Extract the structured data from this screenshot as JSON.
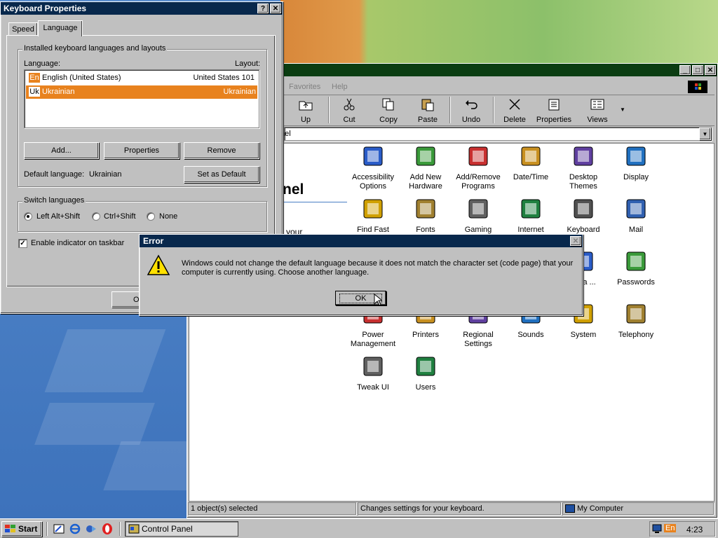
{
  "keyboard_props": {
    "title": "Keyboard Properties",
    "help_btn": "?",
    "close_btn": "✕",
    "tabs": [
      "Speed",
      "Language"
    ],
    "installed_group": "Installed keyboard languages and layouts",
    "col_language": "Language:",
    "col_layout": "Layout:",
    "rows": [
      {
        "code": "En",
        "language": "English (United States)",
        "layout": "United States 101"
      },
      {
        "code": "Uk",
        "language": "Ukrainian",
        "layout": "Ukrainian"
      }
    ],
    "add_btn": "Add...",
    "properties_btn": "Properties",
    "remove_btn": "Remove",
    "default_label": "Default language:",
    "default_value": "Ukrainian",
    "set_default_btn": "Set as Default",
    "switch_group": "Switch languages",
    "switch_options": [
      "Left Alt+Shift",
      "Ctrl+Shift",
      "None"
    ],
    "indicator_label": "Enable indicator on taskbar",
    "ok_partial": "OK"
  },
  "control_panel": {
    "menu": [
      "Favorites",
      "Help"
    ],
    "toolbar": [
      "Up",
      "Cut",
      "Copy",
      "Paste",
      "Undo",
      "Delete",
      "Properties",
      "Views"
    ],
    "address_partial": "nel",
    "left_heading": "nel",
    "left_text": "your",
    "items": [
      {
        "label": "Accessibility Options",
        "icon": "accessibility-icon"
      },
      {
        "label": "Add New Hardware",
        "icon": "hardware-icon"
      },
      {
        "label": "Add/Remove Programs",
        "icon": "programs-icon"
      },
      {
        "label": "Date/Time",
        "icon": "datetime-icon"
      },
      {
        "label": "Desktop Themes",
        "icon": "themes-icon"
      },
      {
        "label": "Display",
        "icon": "display-icon"
      },
      {
        "label": "Find Fast",
        "icon": "findfast-icon"
      },
      {
        "label": "Fonts",
        "icon": "fonts-icon"
      },
      {
        "label": "Gaming",
        "icon": "gaming-icon"
      },
      {
        "label": "Internet",
        "icon": "internet-icon"
      },
      {
        "label": "Keyboard",
        "icon": "keyboard-icon"
      },
      {
        "label": "Mail",
        "icon": "mail-icon"
      },
      {
        "label": "Data ...",
        "icon": "odbc-icon"
      },
      {
        "label": "Passwords",
        "icon": "passwords-icon"
      },
      {
        "label": "Power Management",
        "icon": "power-icon"
      },
      {
        "label": "Printers",
        "icon": "printers-icon"
      },
      {
        "label": "Regional Settings",
        "icon": "regional-icon"
      },
      {
        "label": "Sounds",
        "icon": "sounds-icon"
      },
      {
        "label": "System",
        "icon": "system-icon"
      },
      {
        "label": "Telephony",
        "icon": "telephony-icon"
      },
      {
        "label": "Tweak UI",
        "icon": "tweakui-icon"
      },
      {
        "label": "Users",
        "icon": "users-icon"
      }
    ],
    "status": [
      "1 object(s) selected",
      "Changes settings for your keyboard.",
      "My Computer"
    ]
  },
  "error_dialog": {
    "title": "Error",
    "message": "Windows could not change the default language because it does not match the character set (code page) that your computer is currently using. Choose another language.",
    "ok": "OK"
  },
  "taskbar": {
    "start": "Start",
    "task": "Control Panel",
    "lang": "En",
    "clock": "4:23"
  },
  "colors": {
    "selection": "#e8821e",
    "title_dark": "#08284c",
    "title_green": "#0b3d12"
  }
}
